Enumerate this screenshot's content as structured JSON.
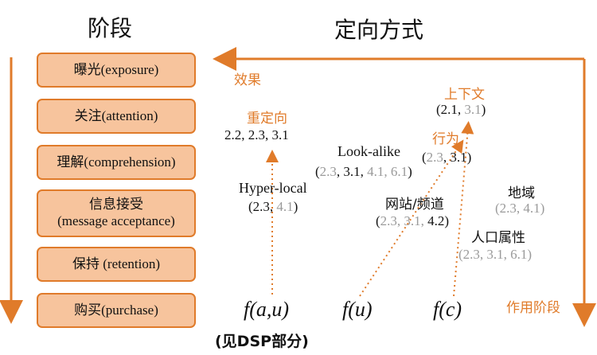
{
  "headers": {
    "stage": "阶段",
    "targeting": "定向方式"
  },
  "stages": [
    {
      "label": "曝光(exposure)"
    },
    {
      "label": "关注(attention)"
    },
    {
      "label": "理解(comprehension)"
    },
    {
      "label_zh": "信息接受",
      "label_en": "(message acceptance)"
    },
    {
      "label": "保持 (retention)"
    },
    {
      "label": "购买(purchase)"
    }
  ],
  "axes": {
    "effect": "效果",
    "stage_of_action": "作用阶段"
  },
  "methods": {
    "retargeting": {
      "name": "重定向",
      "refs": [
        "2.2, 2.3, 3.1"
      ]
    },
    "context": {
      "name": "上下文",
      "refs_dark": "2.1, ",
      "refs_gray": "3.1"
    },
    "behavior": {
      "name": "行为",
      "refs_gray": "2.3",
      "refs_dark": ", 3.1"
    },
    "lookalike": {
      "name": "Look-alike",
      "r1": "2.3",
      "r2": ", 3.1, ",
      "r3": "4.1, 6.1"
    },
    "hyperlocal": {
      "name": "Hyper-local",
      "r1": "2.3, ",
      "r2": "4.1"
    },
    "website": {
      "name": "网站/频道",
      "r1": "2.3, 3.1, ",
      "r2": "4.2"
    },
    "region": {
      "name": "地域",
      "refs": "2.3, 4.1"
    },
    "demographic": {
      "name": "人口属性",
      "refs": "2.3, 3.1, 6.1"
    }
  },
  "functions": {
    "fau": "f(a,u)",
    "fu": "f(u)",
    "fc": "f(c)",
    "note": "(见DSP部分)"
  },
  "colors": {
    "accent": "#e07b2a",
    "box_fill": "#f7c49d",
    "gray_text": "#9a9a9a"
  }
}
